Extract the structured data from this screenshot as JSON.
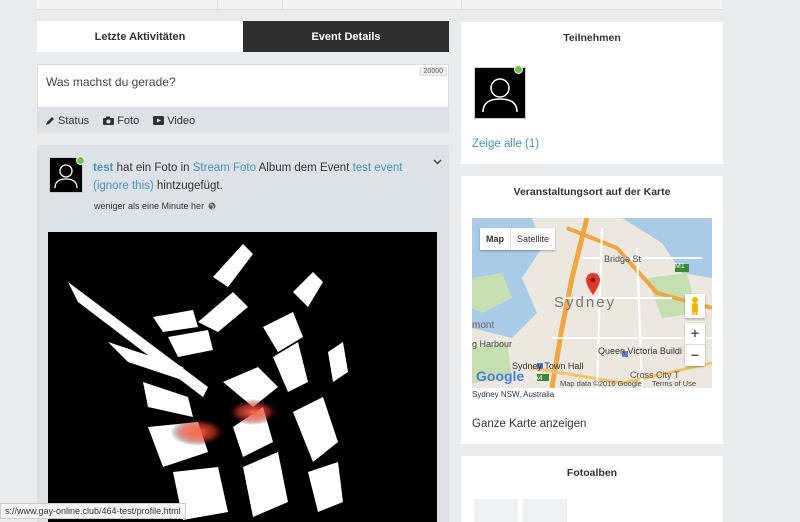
{
  "tabs": [
    {
      "label": "Letzte Aktivitäten",
      "active": false
    },
    {
      "label": "Event Details",
      "active": true
    }
  ],
  "composer": {
    "placeholder": "Was machst du gerade?",
    "char_count": "20000",
    "actions": [
      {
        "label": "Status",
        "icon": "pencil-icon"
      },
      {
        "label": "Foto",
        "icon": "camera-icon"
      },
      {
        "label": "Video",
        "icon": "video-icon"
      }
    ]
  },
  "post": {
    "user": "test",
    "t1": "hat ein Foto in",
    "album_link": "Stream Foto",
    "t2": "Album dem Event",
    "event_link": "test event",
    "ignore_link": "(ignore this)",
    "t3": "hintzugefügt.",
    "time": "weniger als eine Minute her"
  },
  "sidebar": {
    "participate": {
      "title": "Teilnehmen",
      "show_all": "Zeige alle (1)"
    },
    "location": {
      "title": "Veranstaltungsort auf der Karte",
      "map_btn": "Map",
      "satellite_btn": "Satellite",
      "labels": {
        "city": "Sydney",
        "bridge": "Bridge St",
        "qvb": "Queen Victoria Buildi",
        "townhall": "Sydney Town Hall",
        "harbour": "g Harbour",
        "mont": "mont",
        "cross": "Cross City T",
        "m1": "M1",
        "a4": "A4",
        "google": "Google",
        "data": "Map data ©2016 Google",
        "terms": "Terms of Use"
      },
      "address": "Sydney NSW, Australia",
      "full_map": "Ganze Karte anzeigen"
    },
    "albums": {
      "title": "Fotoalben"
    }
  },
  "status_url": "s://www.gay-online.club/464-test/profile.html",
  "colors": {
    "accent": "#4a90c7",
    "online": "#6dc34d",
    "dark_tab": "#2f2f2f"
  }
}
